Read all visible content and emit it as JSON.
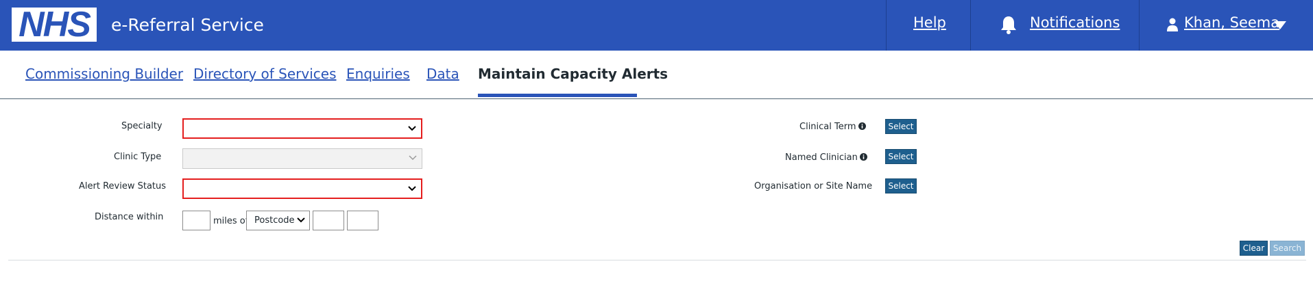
{
  "header": {
    "logo_text": "NHS",
    "service_name": "e-Referral Service",
    "help_label": "Help",
    "notifications_label": "Notifications",
    "user_name": "Khan, Seema",
    "background_color": "#2a54b8"
  },
  "nav": {
    "items": [
      {
        "label": "Commissioning Builder"
      },
      {
        "label": "Directory of Services"
      },
      {
        "label": "Enquiries"
      },
      {
        "label": "Data"
      },
      {
        "label": "Maintain Capacity Alerts"
      }
    ],
    "active_index": 4
  },
  "form": {
    "specialty_label": "Specialty",
    "clinic_type_label": "Clinic Type",
    "alert_review_status_label": "Alert Review Status",
    "distance_within_label": "Distance within",
    "miles_of_label": "miles of",
    "postcode_option": "Postcode",
    "specialty_value": "",
    "clinic_type_value": "",
    "alert_review_status_value": "",
    "distance_value": "",
    "postcode_part1": "",
    "postcode_part2": "",
    "clinical_term_label": "Clinical Term",
    "named_clinician_label": "Named Clinician",
    "organisation_label": "Organisation or Site Name",
    "select_label": "Select",
    "error_color": "#e41d1d"
  },
  "actions": {
    "clear_label": "Clear",
    "search_label": "Search"
  }
}
